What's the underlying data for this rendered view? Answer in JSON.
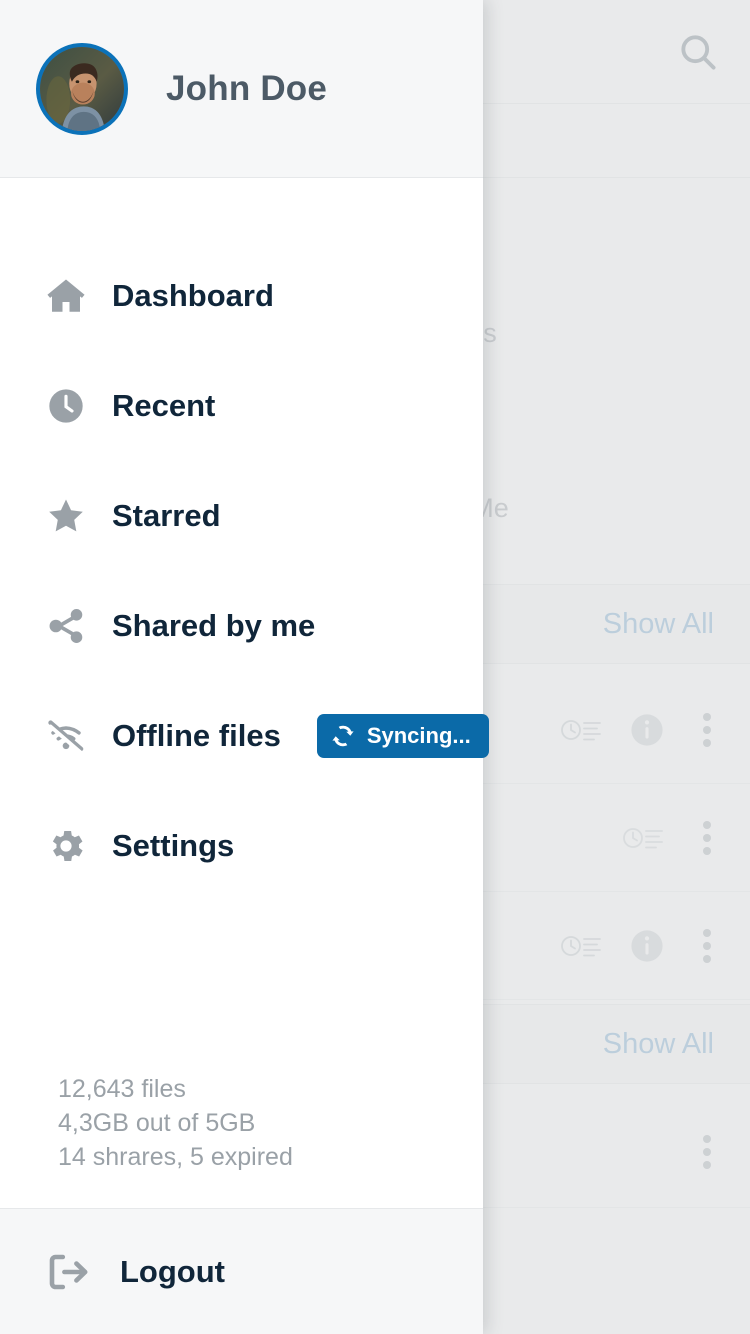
{
  "drawer": {
    "user": {
      "name": "John Doe",
      "avatar_icon": "user-photo-avatar",
      "ring_color": "#0b72b9"
    },
    "nav": [
      {
        "label": "Dashboard",
        "icon": "home-icon"
      },
      {
        "label": "Recent",
        "icon": "clock-icon"
      },
      {
        "label": "Starred",
        "icon": "star-icon"
      },
      {
        "label": "Shared by me",
        "icon": "share-icon"
      },
      {
        "label": "Offline files",
        "icon": "wifi-off-icon",
        "badge": {
          "label": "Syncing...",
          "icon": "sync-icon",
          "color": "#0b6aa8"
        }
      },
      {
        "label": "Settings",
        "icon": "gear-icon"
      }
    ],
    "stats": {
      "files": "12,643 files",
      "storage": "4,3GB out of 5GB",
      "shares": "14 shrares, 5 expired"
    },
    "footer": {
      "label": "Logout",
      "icon": "logout-icon"
    }
  },
  "background": {
    "topbar": {
      "search_icon": "search-icon"
    },
    "tiles": [
      {
        "label": "Team Folders",
        "icon": "folder-team-icon",
        "color": "#86b0ce"
      },
      {
        "label": "Shared with Me",
        "icon": "folder-shared-icon",
        "color": "#86b0ce"
      }
    ],
    "show_all_label": "Show All",
    "link_color": "#5b9bc9",
    "rows": [
      {
        "icons": [
          "activity-icon",
          "info-icon",
          "more-vertical-icon"
        ]
      },
      {
        "icons": [
          "activity-icon",
          "more-vertical-icon"
        ]
      },
      {
        "icons": [
          "activity-icon",
          "info-icon",
          "more-vertical-icon"
        ]
      },
      {
        "icons": [
          "more-vertical-icon"
        ]
      }
    ]
  }
}
